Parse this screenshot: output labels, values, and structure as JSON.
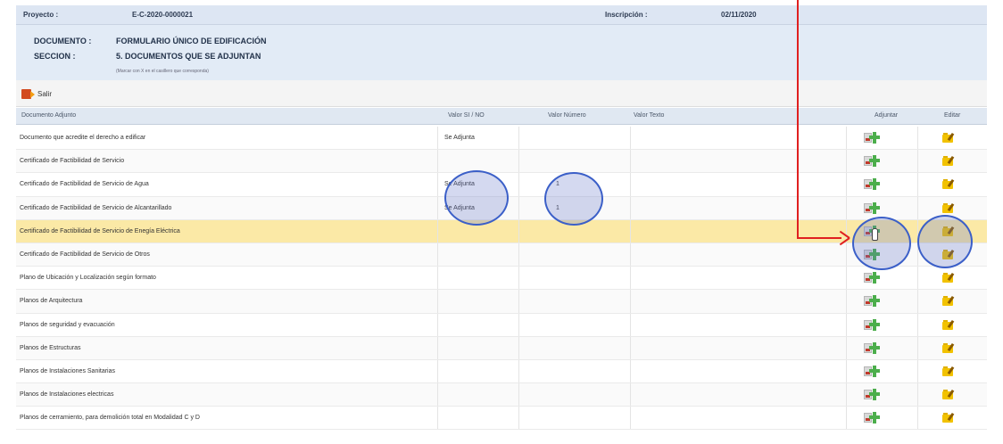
{
  "header": {
    "project_label": "Proyecto :",
    "project_value": "E-C-2020-0000021",
    "registration_label": "Inscripción :",
    "registration_value": "02/11/2020"
  },
  "document": {
    "document_label": "DOCUMENTO :",
    "document_value": "FORMULARIO ÚNICO DE EDIFICACIÓN",
    "section_label": "SECCION :",
    "section_value": "5. DOCUMENTOS QUE SE ADJUNTAN",
    "note": "(Marcar con X en el casillero que corresponda)"
  },
  "toolbar": {
    "exit_label": "Salir"
  },
  "table": {
    "columns": {
      "document": "Documento Adjunto",
      "yes_no": "Valor  SI / NO",
      "number": "Valor  Número",
      "text": "Valor  Texto",
      "attach": "Adjuntar",
      "edit": "Editar"
    },
    "rows": [
      {
        "doc": "Documento que acredite el derecho a edificar",
        "si": "Se Adjunta",
        "num": ""
      },
      {
        "doc": "Certificado de Factibilidad de Servicio",
        "si": "",
        "num": ""
      },
      {
        "doc": "Certificado de Factibilidad de Servicio de Agua",
        "si": "Se Adjunta",
        "num": "1"
      },
      {
        "doc": "Certificado de Factibilidad de Servicio de Alcantarillado",
        "si": "Se Adjunta",
        "num": "1"
      },
      {
        "doc": "Certificado de Factibilidad de Servicio de Enegía Eléctrica",
        "si": "",
        "num": ""
      },
      {
        "doc": "Certificado de Factibilidad de Servicio de Otros",
        "si": "",
        "num": ""
      },
      {
        "doc": "Plano de Ubicación y Localización según formato",
        "si": "",
        "num": ""
      },
      {
        "doc": "Planos de Arquitectura",
        "si": "",
        "num": ""
      },
      {
        "doc": "Planos de seguridad y evacuación",
        "si": "",
        "num": ""
      },
      {
        "doc": "Planos de Estructuras",
        "si": "",
        "num": ""
      },
      {
        "doc": "Planos de Instalaciones Sanitarias",
        "si": "",
        "num": ""
      },
      {
        "doc": "Planos de Instalaciones electricas",
        "si": "",
        "num": ""
      },
      {
        "doc": "Planos de cerramiento, para demolición total en Modalidad C y D",
        "si": "",
        "num": ""
      }
    ],
    "highlighted_row": 4
  },
  "colors": {
    "highlight_row": "#fbe9a6",
    "annotation_circle": "#3b5fc8",
    "annotation_arrow": "#e02020"
  },
  "icons": {
    "attach": "add-attachment-icon",
    "edit": "edit-folder-icon",
    "exit": "exit-icon"
  }
}
